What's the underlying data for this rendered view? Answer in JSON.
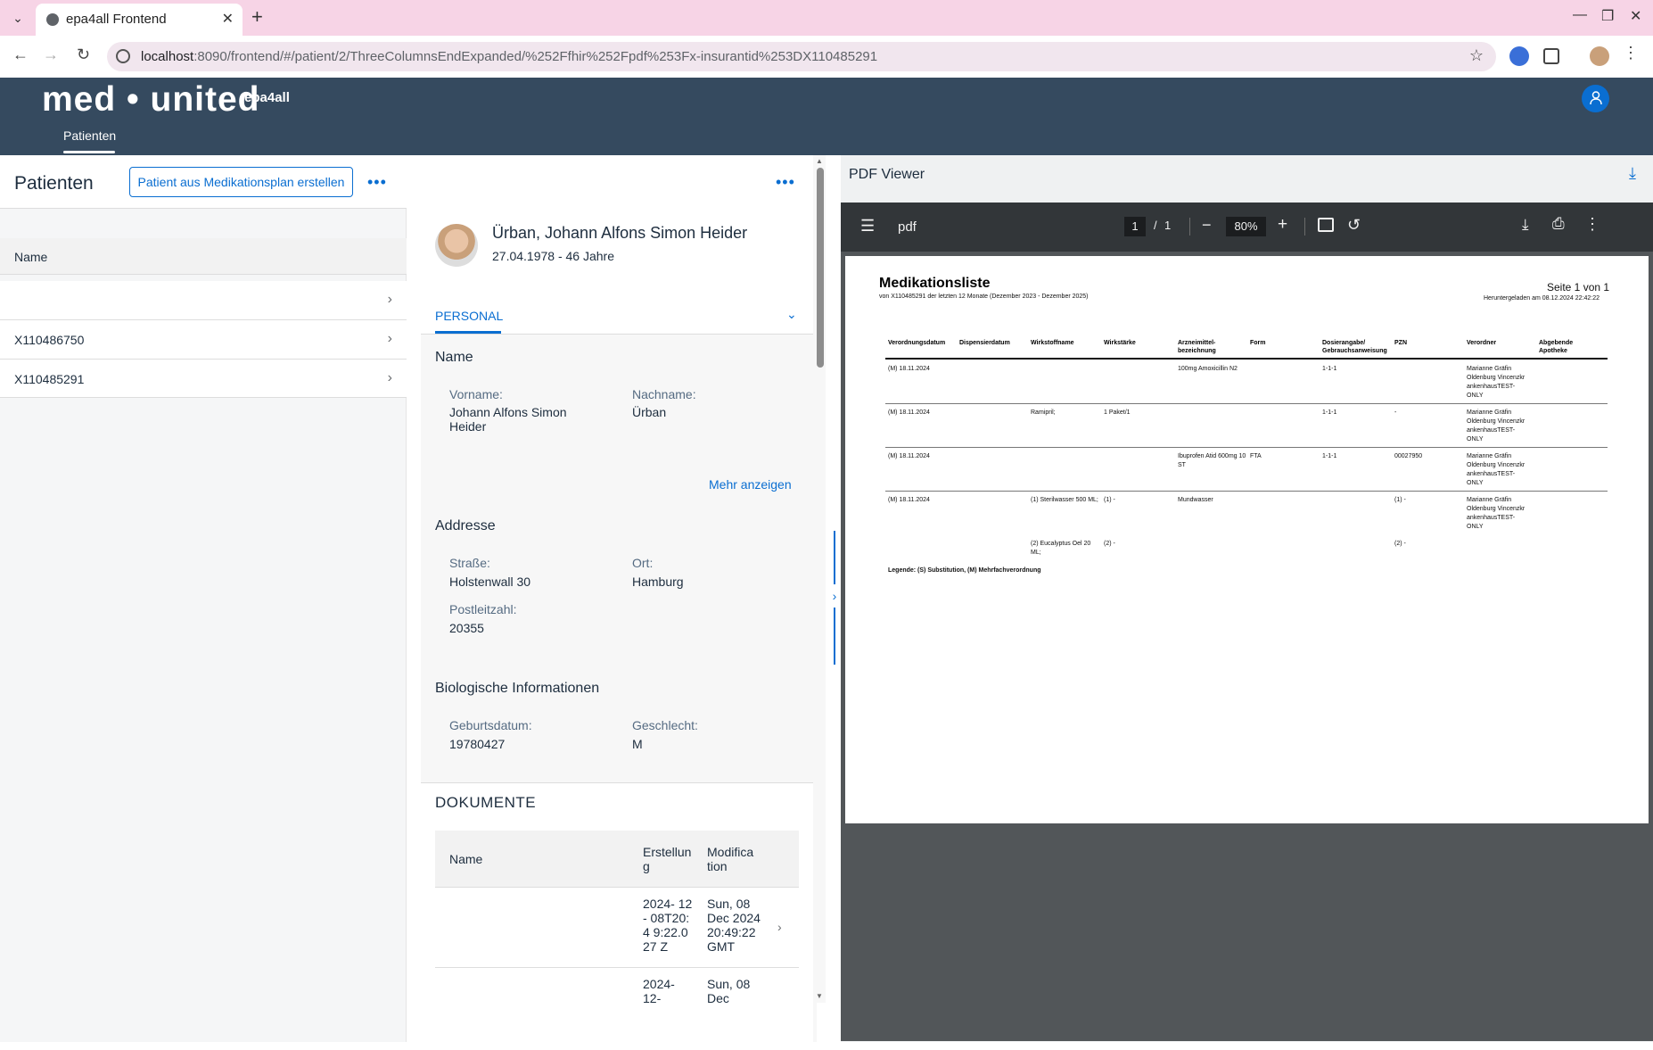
{
  "browser": {
    "tab_title": "epa4all Frontend",
    "url_host": "localhost",
    "url_rest": ":8090/frontend/#/patient/2/ThreeColumnsEndExpanded/%252Ffhir%252Fpdf%253Fx-insurantid%253DX110485291"
  },
  "app": {
    "logo": "med • united",
    "logo_sub": "epa4all",
    "nav_item": "Patienten"
  },
  "patients": {
    "title": "Patienten",
    "create_button": "Patient aus Medikationsplan erstellen",
    "more": "•••",
    "column_name": "Name",
    "rows": [
      "",
      "X110486750",
      "X110485291"
    ]
  },
  "patient": {
    "name": "Ürban, Johann Alfons Simon Heider",
    "dob_age": "27.04.1978 - 46 Jahre",
    "tab": "PERSONAL",
    "more": "•••",
    "name_section": "Name",
    "vorname_label": "Vorname:",
    "vorname": "Johann Alfons Simon Heider",
    "nachname_label": "Nachname:",
    "nachname": "Ürban",
    "mehr": "Mehr anzeigen",
    "address_section": "Addresse",
    "strasse_label": "Straße:",
    "strasse": "Holstenwall 30",
    "ort_label": "Ort:",
    "ort": "Hamburg",
    "plz_label": "Postleitzahl:",
    "plz": "20355",
    "bio_section": "Biologische Informationen",
    "geb_label": "Geburtsdatum:",
    "geb": "19780427",
    "geschlecht_label": "Geschlecht:",
    "geschlecht": "M"
  },
  "documents": {
    "title": "DOKUMENTE",
    "col_name": "Name",
    "col_created": "Erstellun g",
    "col_modified": "Modifica tion",
    "rows": [
      {
        "name": "",
        "created": "2024- 12- 08T20:4 9:22.027 Z",
        "modified": "Sun, 08 Dec 2024 20:49:22 GMT"
      },
      {
        "name": "",
        "created": "2024- 12-",
        "modified": "Sun, 08 Dec"
      }
    ]
  },
  "viewer": {
    "title": "PDF Viewer",
    "doc_name": "pdf",
    "page_current": "1",
    "page_sep": "/",
    "page_total": "1",
    "zoom": "80%"
  },
  "pdf_doc": {
    "title": "Medikationsliste",
    "subtitle": "von X110485291 der letzten 12 Monate (Dezember 2023 - Dezember 2025)",
    "page_info": "Seite 1 von 1",
    "downloaded": "Heruntergeladen am 08.12.2024 22:42:22",
    "headers": [
      "Verordnungsdatum",
      "Dispensierdatum",
      "Wirkstoffname",
      "Wirkstärke",
      "Arzneimittel- bezeichnung",
      "Form",
      "Dosierangabe/ Gebrauchsanweisung",
      "PZN",
      "Verordner",
      "Abgebende Apotheke"
    ],
    "rows": [
      [
        "(M) 18.11.2024",
        "",
        "",
        "",
        "100mg Amoxicillin N2",
        "",
        "1-1-1",
        "",
        "Marianne Gräfin Oldenburg Vincenzkr ankenhausTEST- ONLY",
        ""
      ],
      [
        "(M) 18.11.2024",
        "",
        "Ramipril;",
        "1 Paket/1",
        "",
        "",
        "1-1-1",
        "-",
        "Marianne Gräfin Oldenburg Vincenzkr ankenhausTEST- ONLY",
        ""
      ],
      [
        "(M) 18.11.2024",
        "",
        "",
        "",
        "Ibuprofen Atid 600mg 10 ST",
        "FTA",
        "1-1-1",
        "00027950",
        "Marianne Gräfin Oldenburg Vincenzkr ankenhausTEST- ONLY",
        ""
      ],
      [
        "(M) 18.11.2024",
        "",
        "(1) Sterilwasser 500 ML;",
        "(1) -",
        "Mundwasser",
        "",
        "",
        "(1) -",
        "Marianne Gräfin Oldenburg Vincenzkr ankenhausTEST- ONLY",
        ""
      ],
      [
        "",
        "",
        "(2) Eucalyptus Oel 20 ML;",
        "(2) -",
        "",
        "",
        "",
        "(2) -",
        "",
        ""
      ]
    ],
    "legend": "Legende: (S) Substitution, (M) Mehrfachverordnung"
  },
  "colors": {
    "shell": "#354a5f",
    "accent": "#0a6ed1",
    "tabstrip": "#f7d4e6",
    "pdf_toolbar": "#323639",
    "pdf_bg": "#525659"
  },
  "icons": [
    "tab-dropdown-icon",
    "globe-icon",
    "close-icon",
    "plus-icon",
    "minimize-icon",
    "restore-icon",
    "back-icon",
    "forward-icon",
    "reload-icon",
    "info-icon",
    "star-icon",
    "extension-icon",
    "profile-avatar-icon",
    "user-icon",
    "chevron-right-icon",
    "chevron-down-icon",
    "menu-icon",
    "download-icon",
    "print-icon",
    "more-vertical-icon",
    "fit-page-icon",
    "rotate-icon",
    "zoom-in-icon",
    "zoom-out-icon"
  ]
}
